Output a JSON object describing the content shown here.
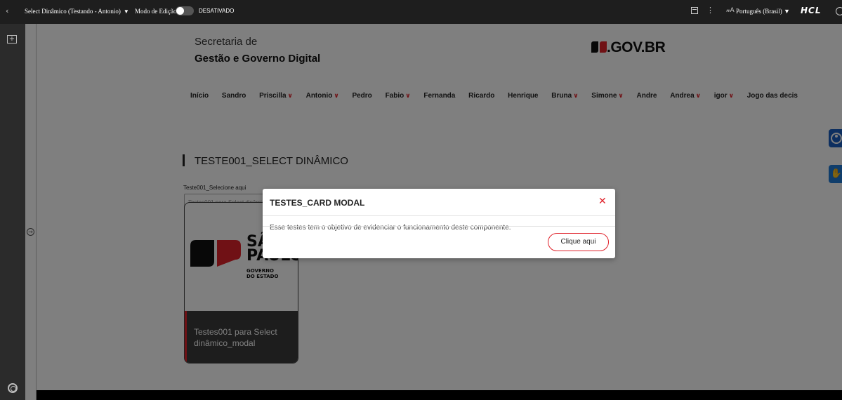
{
  "topbar": {
    "back_icon": "chevron-left-icon",
    "page_title": "Select Dinâmico (Testando - Antonio)",
    "edit_mode_label": "Modo de Edição:",
    "edit_mode_status": "DESATIVADO",
    "language": "Português (Brasil)",
    "brand": "HCL"
  },
  "site": {
    "org_line1": "Secretaria de",
    "org_line2": "Gestão e Governo Digital",
    "logo_text": ".GOV.BR",
    "nav": [
      {
        "label": "Início",
        "dropdown": false
      },
      {
        "label": "Sandro",
        "dropdown": false
      },
      {
        "label": "Priscilla",
        "dropdown": true
      },
      {
        "label": "Antonio",
        "dropdown": true
      },
      {
        "label": "Pedro",
        "dropdown": false
      },
      {
        "label": "Fabio",
        "dropdown": true
      },
      {
        "label": "Fernanda",
        "dropdown": false
      },
      {
        "label": "Ricardo",
        "dropdown": false
      },
      {
        "label": "Henrique",
        "dropdown": false
      },
      {
        "label": "Bruna",
        "dropdown": true
      },
      {
        "label": "Simone",
        "dropdown": true
      },
      {
        "label": "Andre",
        "dropdown": false
      },
      {
        "label": "Andrea",
        "dropdown": true
      },
      {
        "label": "igor",
        "dropdown": true
      },
      {
        "label": "Jogo das decis",
        "dropdown": false
      }
    ],
    "page_title": "TESTE001_SELECT DINÂMICO",
    "select_label": "Teste001_Selecione aqui",
    "select_value": "Testes001 para Select dinâmico_modal",
    "card": {
      "logo_line1": "SÃO",
      "logo_line2": "PAULO",
      "logo_sub1": "GOVERNO",
      "logo_sub2": "DO ESTADO",
      "caption": "Testes001 para Select dinâmico_modal"
    }
  },
  "modal": {
    "title": "TESTES_CARD MODAL",
    "body": "Esse testes tem o objetivo de evidenciar o funcionamento deste componente.",
    "button_label": "Clique aqui"
  },
  "colors": {
    "accent_red": "#e0222b",
    "toolbar_bg": "#1e1e1e",
    "a11y_blue": "#1b5fc1"
  }
}
